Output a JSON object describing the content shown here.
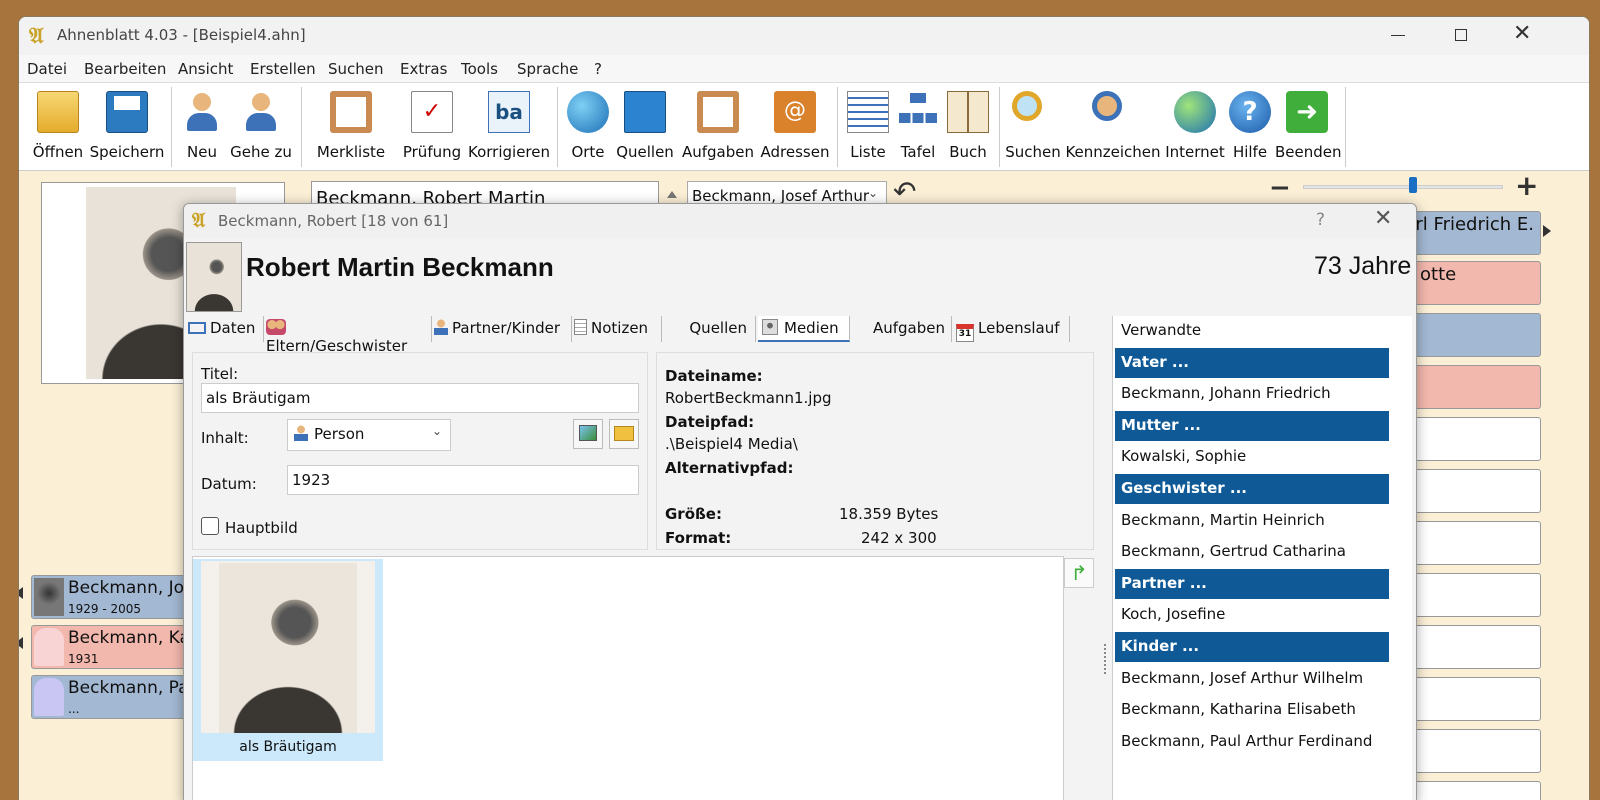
{
  "window": {
    "title": "Ahnenblatt 4.03 - [Beispiel4.ahn]"
  },
  "menu": [
    "Datei",
    "Bearbeiten",
    "Ansicht",
    "Erstellen",
    "Suchen",
    "Extras",
    "Tools",
    "Sprache",
    "?"
  ],
  "toolbar": {
    "oeffnen": "Öffnen",
    "speichern": "Speichern",
    "neu": "Neu",
    "gehe_zu": "Gehe zu",
    "merkliste": "Merkliste",
    "pruefung": "Prüfung",
    "korrigieren": "Korrigieren",
    "orte": "Orte",
    "quellen": "Quellen",
    "aufgaben": "Aufgaben",
    "adressen": "Adressen",
    "liste": "Liste",
    "tafel": "Tafel",
    "buch": "Buch",
    "suchen": "Suchen",
    "kennzeichen": "Kennzeichen",
    "internet": "Internet",
    "hilfe": "Hilfe",
    "beenden": "Beenden"
  },
  "main": {
    "person_name": "Beckmann, Robert Martin",
    "partner_select": "Beckmann, Josef Arthur",
    "zoom_level": 0.55,
    "right_top": "rl Friedrich E.",
    "right_second": "otte",
    "children": [
      {
        "name": "Beckmann, Jo",
        "years": "1929 - 2005"
      },
      {
        "name": "Beckmann, Ka",
        "years": "1931"
      },
      {
        "name": "Beckmann, Pa",
        "years": "..."
      }
    ]
  },
  "dialog": {
    "title": "Beckmann, Robert [18 von 61]",
    "help": "?",
    "name": "Robert Martin Beckmann",
    "age": "73 Jahre",
    "tabs": [
      "Daten",
      "Eltern/Geschwister",
      "Partner/Kinder",
      "Notizen",
      "Quellen",
      "Medien",
      "Aufgaben",
      "Lebenslauf"
    ],
    "calendar_day": "31",
    "form": {
      "titel_label": "Titel:",
      "titel_value": "als Bräutigam",
      "inhalt_label": "Inhalt:",
      "inhalt_value": "Person",
      "datum_label": "Datum:",
      "datum_value": "1923",
      "hauptbild_label": "Hauptbild"
    },
    "info": {
      "dateiname_label": "Dateiname:",
      "dateiname": "RobertBeckmann1.jpg",
      "dateipfad_label": "Dateipfad:",
      "dateipfad": ".\\Beispiel4 Media\\",
      "alternativ_label": "Alternativpfad:",
      "groesse_label": "Größe:",
      "groesse": "18.359 Bytes",
      "format_label": "Format:",
      "format": "242 x 300"
    },
    "thumb_caption": "als Bräutigam",
    "relatives": [
      {
        "text": "Verwandte",
        "header": false
      },
      {
        "text": "Vater ...",
        "header": true
      },
      {
        "text": "Beckmann, Johann Friedrich",
        "header": false
      },
      {
        "text": "Mutter ...",
        "header": true
      },
      {
        "text": "Kowalski, Sophie",
        "header": false
      },
      {
        "text": "Geschwister ...",
        "header": true
      },
      {
        "text": "Beckmann, Martin Heinrich",
        "header": false
      },
      {
        "text": "Beckmann, Gertrud Catharina",
        "header": false
      },
      {
        "text": "Partner ...",
        "header": true
      },
      {
        "text": "Koch, Josefine",
        "header": false
      },
      {
        "text": "Kinder ...",
        "header": true
      },
      {
        "text": "Beckmann, Josef Arthur Wilhelm",
        "header": false
      },
      {
        "text": "Beckmann, Katharina Elisabeth",
        "header": false
      },
      {
        "text": "Beckmann, Paul Arthur Ferdinand",
        "header": false
      }
    ]
  }
}
